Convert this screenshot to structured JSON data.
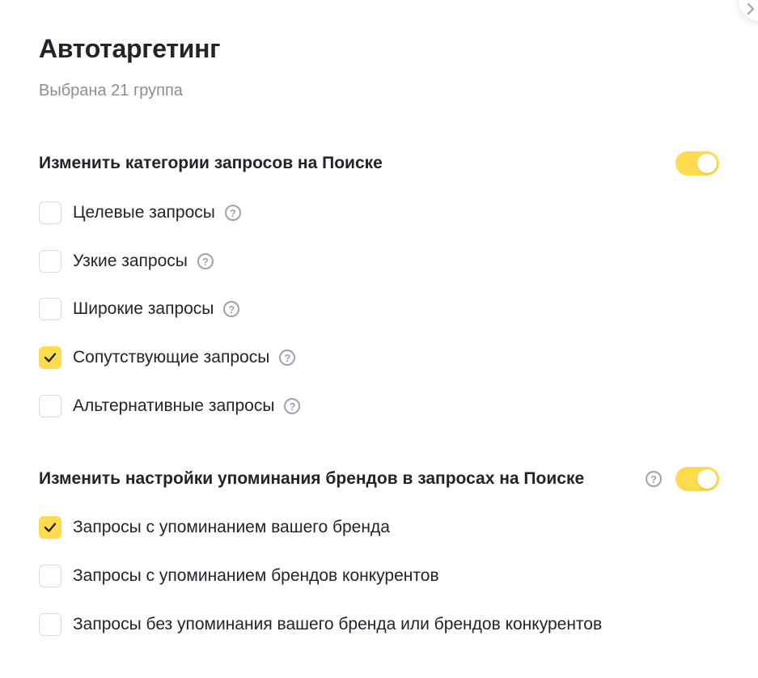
{
  "title": "Автотаргетинг",
  "subtitle": "Выбрана 21 группа",
  "help_glyph": "?",
  "accent_color": "#ffdb4d",
  "section_search": {
    "heading": "Изменить категории запросов на Поиске",
    "toggle_on": true,
    "items": [
      {
        "label": "Целевые запросы",
        "checked": false
      },
      {
        "label": "Узкие запросы",
        "checked": false
      },
      {
        "label": "Широкие запросы",
        "checked": false
      },
      {
        "label": "Сопутствующие запросы",
        "checked": true
      },
      {
        "label": "Альтернативные запросы",
        "checked": false
      }
    ]
  },
  "section_brands": {
    "heading": "Изменить настройки упоминания брендов в запросах на Поиске",
    "toggle_on": true,
    "items": [
      {
        "label": "Запросы с упоминанием вашего бренда",
        "checked": true
      },
      {
        "label": "Запросы с упоминанием брендов конкурентов",
        "checked": false
      },
      {
        "label": "Запросы без упоминания вашего бренда или брендов конкурентов",
        "checked": false
      }
    ]
  }
}
